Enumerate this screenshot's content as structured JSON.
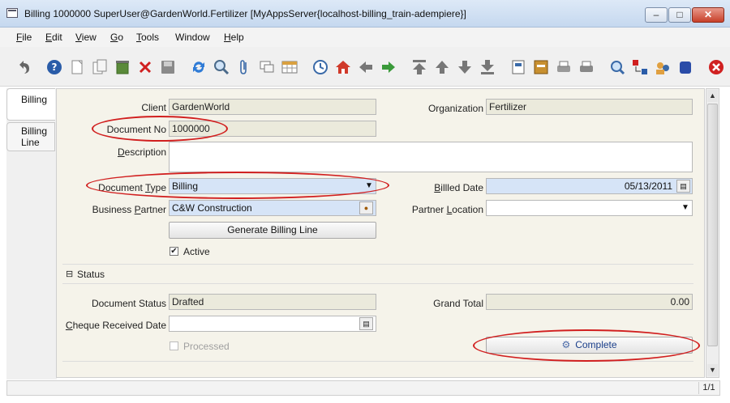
{
  "window": {
    "title": "Billing  1000000  SuperUser@GardenWorld.Fertilizer [MyAppsServer{localhost-billing_train-adempiere}]",
    "min_glyph": "‒",
    "max_glyph": "□",
    "close_glyph": "✕"
  },
  "menu": [
    {
      "key": "F",
      "rest": "ile"
    },
    {
      "key": "E",
      "rest": "dit"
    },
    {
      "key": "V",
      "rest": "iew"
    },
    {
      "key": "G",
      "rest": "o"
    },
    {
      "key": "T",
      "rest": "ools"
    },
    {
      "key": "",
      "rest": "Window"
    },
    {
      "key": "H",
      "rest": "elp"
    }
  ],
  "toolbar_icons": [
    "undo-icon",
    "help-icon",
    "new-record-icon",
    "copy-record-icon",
    "delete-icon",
    "delete-selection-icon",
    "save-icon",
    "refresh-icon",
    "find-icon",
    "attachment-icon",
    "chat-icon",
    "grid-toggle-icon",
    "history-icon",
    "home-icon",
    "previous-icon",
    "next-icon",
    "first-record-icon",
    "previous-record-icon",
    "next-record-icon",
    "last-record-icon",
    "report-icon",
    "archive-icon",
    "print-preview-icon",
    "print-icon",
    "zoom-across-icon",
    "workflow-icon",
    "request-icon",
    "product-info-icon",
    "exit-icon"
  ],
  "tabs": {
    "billing": "Billing",
    "billing_line_1": "Billing",
    "billing_line_2": "Line"
  },
  "form": {
    "client_label": "Client",
    "client_value": "GardenWorld",
    "organization_label": "Organization",
    "organization_value": "Fertilizer",
    "docno_label": "Document No",
    "docno_value": "1000000",
    "description_label_key": "D",
    "description_label_rest": "escription",
    "description_value": "",
    "doctype_label_a": "Document ",
    "doctype_label_key": "T",
    "doctype_label_b": "ype",
    "doctype_value": "Billing",
    "billed_date_label_key": "B",
    "billed_date_label_rest": "illled Date",
    "billed_date_value": "05/13/2011",
    "bp_label_a": "Business ",
    "bp_label_key": "P",
    "bp_label_b": "artner",
    "bp_value": "C&W Construction",
    "partner_location_label_a": "Partner ",
    "partner_location_label_key": "L",
    "partner_location_label_b": "ocation",
    "partner_location_value": "",
    "generate_button": "Generate Billing Line",
    "active_label": "Active",
    "active_checked": "✔",
    "status_group_toggle": "⊟",
    "status_group_label": "Status",
    "doc_status_label": "Document Status",
    "doc_status_value": "Drafted",
    "grand_total_label": "Grand Total",
    "grand_total_value": "0.00",
    "cheque_label_key": "C",
    "cheque_label_rest": "heque Received Date",
    "cheque_value": "",
    "processed_label": "Processed",
    "complete_button": "Complete"
  },
  "status_bar": {
    "record_position": "1/1"
  }
}
